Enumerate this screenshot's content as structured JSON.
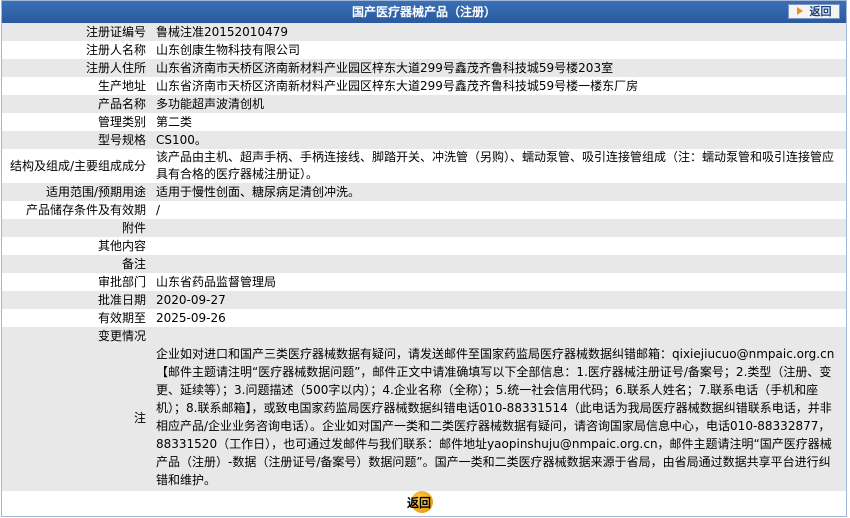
{
  "header": {
    "title": "国产医疗器械产品（注册）",
    "back_label": "返回"
  },
  "rows": [
    {
      "label": "注册证编号",
      "value": "鲁械注准20152010479"
    },
    {
      "label": "注册人名称",
      "value": "山东创康生物科技有限公司"
    },
    {
      "label": "注册人住所",
      "value": "山东省济南市天桥区济南新材料产业园区梓东大道299号鑫茂齐鲁科技城59号楼203室"
    },
    {
      "label": "生产地址",
      "value": "山东省济南市天桥区济南新材料产业园区梓东大道299号鑫茂齐鲁科技城59号楼一楼东厂房"
    },
    {
      "label": "产品名称",
      "value": "多功能超声波清创机"
    },
    {
      "label": "管理类别",
      "value": "第二类"
    },
    {
      "label": "型号规格",
      "value": "CS100。"
    },
    {
      "label": "结构及组成/主要组成成分",
      "value": "该产品由主机、超声手柄、手柄连接线、脚踏开关、冲洗管（另购）、蠕动泵管、吸引连接管组成（注：蠕动泵管和吸引连接管应具有合格的医疗器械注册证）。"
    },
    {
      "label": "适用范围/预期用途",
      "value": "适用于慢性创面、糖尿病足清创冲洗。"
    },
    {
      "label": "产品储存条件及有效期",
      "value": "/"
    },
    {
      "label": "附件",
      "value": ""
    },
    {
      "label": "其他内容",
      "value": ""
    },
    {
      "label": "备注",
      "value": ""
    },
    {
      "label": "审批部门",
      "value": "山东省药品监督管理局"
    },
    {
      "label": "批准日期",
      "value": "2020-09-27"
    },
    {
      "label": "有效期至",
      "value": "2025-09-26"
    },
    {
      "label": "变更情况",
      "value": ""
    },
    {
      "label": "注",
      "value": "企业如对进口和国产三类医疗器械数据有疑问，请发送邮件至国家药监局医疗器械数据纠错邮箱：qixiejiucuo@nmpaic.org.cn【邮件主题请注明“医疗器械数据问题”，邮件正文中请准确填写以下全部信息：1.医疗器械注册证号/备案号；2.类型（注册、变更、延续等）；3.问题描述（500字以内）；4.企业名称（全称）；5.统一社会信用代码；6.联系人姓名；7.联系电话（手机和座机）；8.联系邮箱】，或致电国家药监局医疗器械数据纠错电话010-88331514（此电话为我局医疗器械数据纠错联系电话，并非相应产品/企业业务咨询电话）。企业如对国产一类和二类医疗器械数据有疑问，请咨询国家局信息中心，电话010-88332877，88331520（工作日），也可通过发邮件与我们联系：邮件地址yaopinshuju@nmpaic.org.cn，邮件主题请注明“国产医疗器械产品（注册）-数据（注册证号/备案号）数据问题”。国产一类和二类医疗器械数据来源于省局，由省局通过数据共享平台进行纠错和维护。"
    }
  ],
  "footer": {
    "back_label": "返回"
  },
  "colors": {
    "title_bar": "#2a5aa0",
    "row_alt": "#e8e8e8",
    "button_icon": "#f28c1a"
  }
}
